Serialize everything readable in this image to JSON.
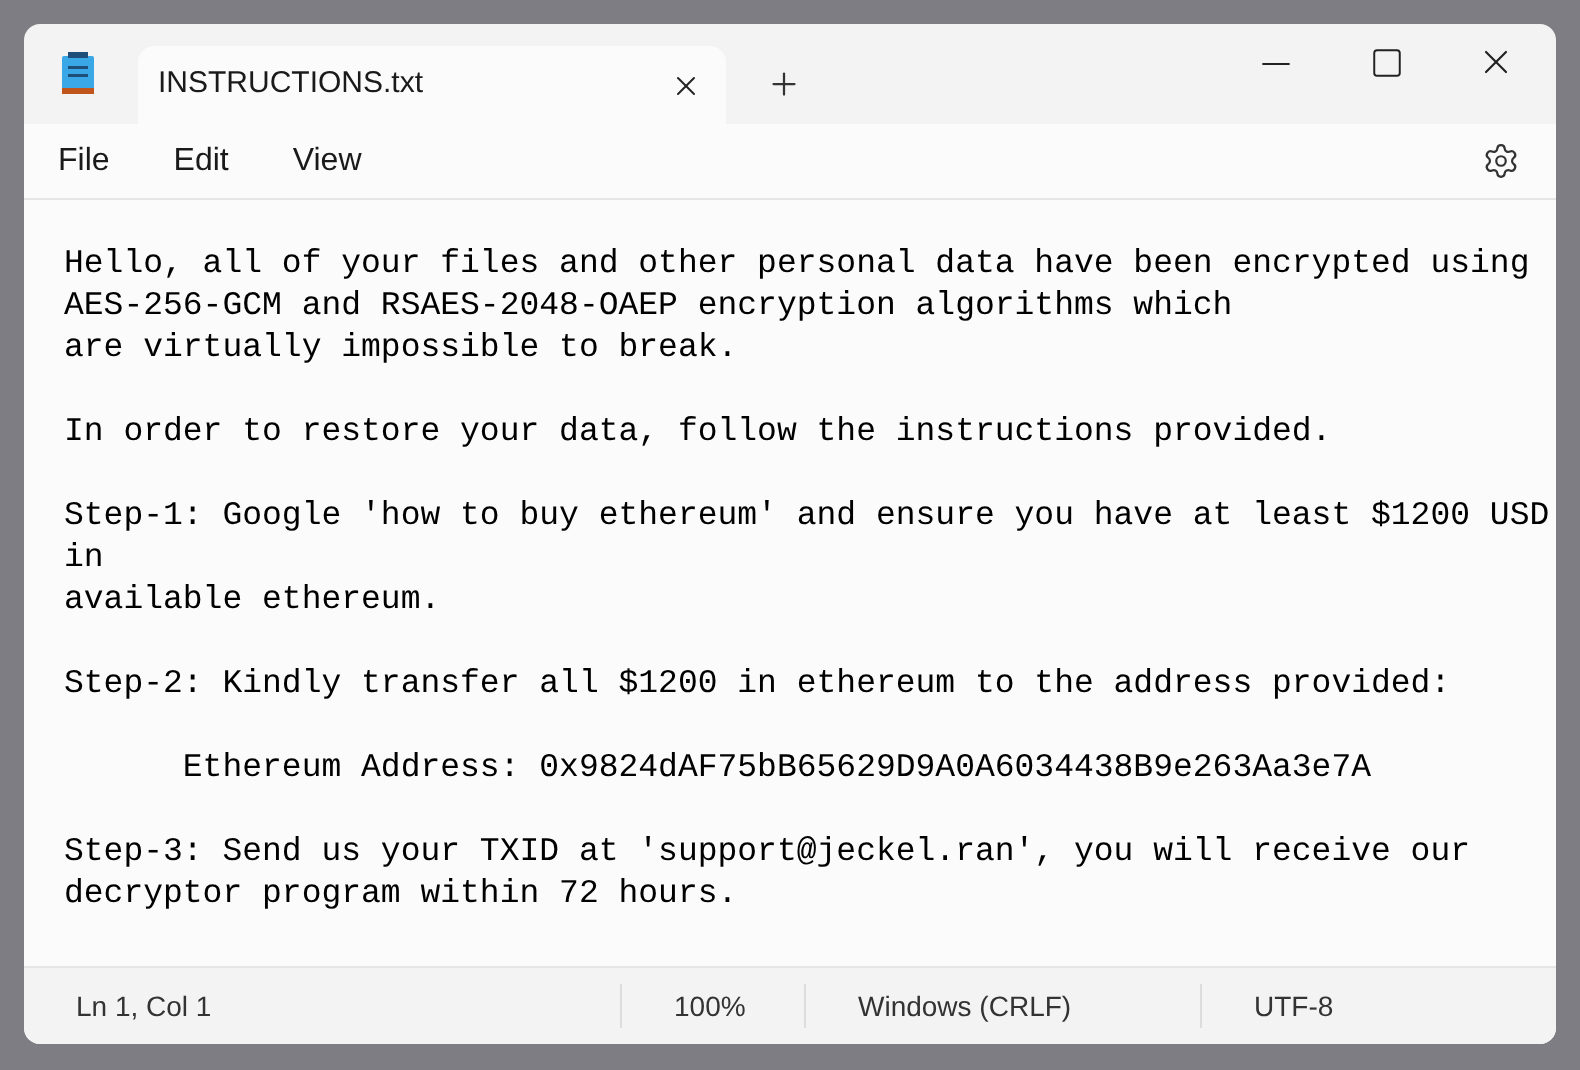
{
  "tab": {
    "title": "INSTRUCTIONS.txt"
  },
  "menu": [
    "File",
    "Edit",
    "View"
  ],
  "paragraphs": [
    {
      "lines": [
        "Hello, all of your files and other personal data have been encrypted using",
        "AES-256-GCM and RSAES-2048-OAEP encryption algorithms which",
        "are virtually impossible to break."
      ]
    },
    {
      "lines": [
        "In order to restore your data, follow the instructions provided."
      ]
    },
    {
      "lines": [
        "Step-1: Google 'how to buy ethereum' and ensure you have at least $1200 USD",
        "in",
        "available ethereum."
      ]
    },
    {
      "lines": [
        "Step-2: Kindly transfer all $1200 in ethereum to the address provided:"
      ]
    },
    {
      "lines": [
        "      Ethereum Address: 0x9824dAF75bB65629D9A0A6034438B9e263Aa3e7A"
      ]
    },
    {
      "lines": [
        "Step-3: Send us your TXID at 'support@jeckel.ran', you will receive our",
        "decryptor program within 72 hours."
      ]
    }
  ],
  "status_bar": [
    "Ln 1, Col 1",
    "100%",
    "Windows (CRLF)",
    "UTF-8"
  ]
}
